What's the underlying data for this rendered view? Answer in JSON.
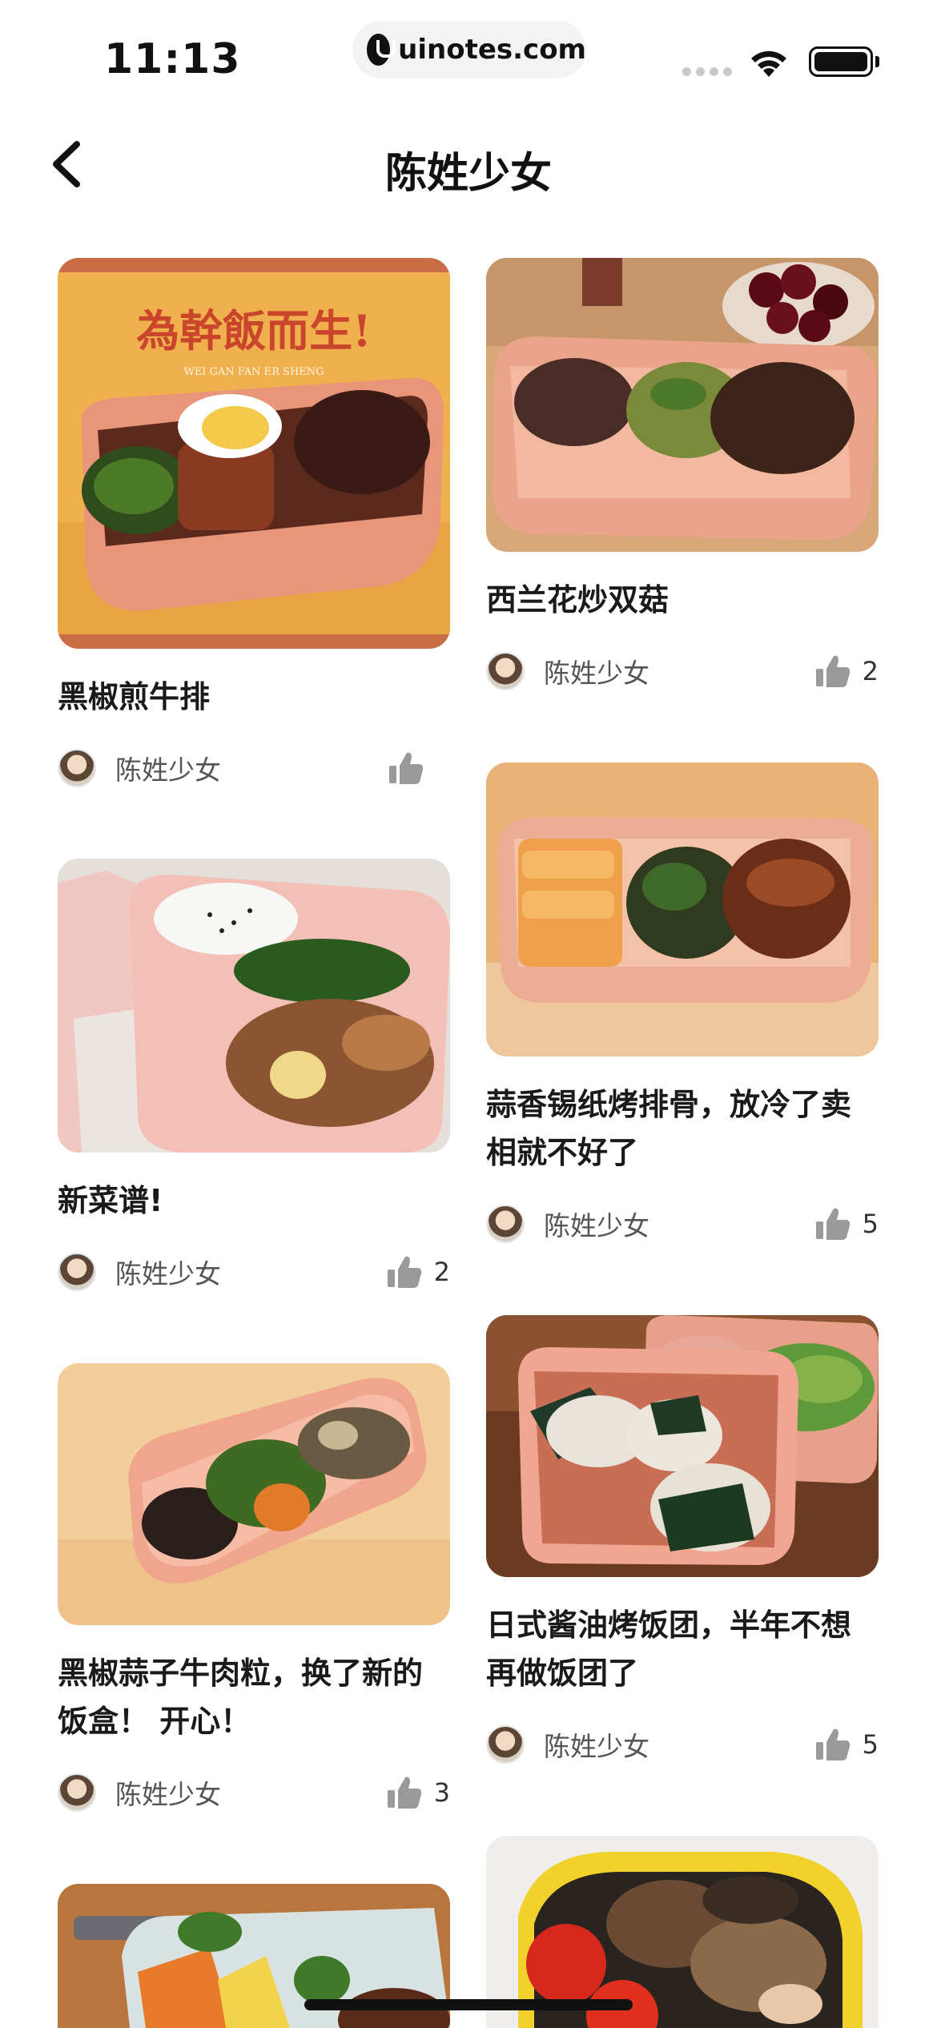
{
  "status": {
    "time": "11:13",
    "url": "uinotes.com",
    "icons": [
      "uinotes-logo-icon",
      "signal-icon",
      "wifi-icon",
      "battery-icon"
    ]
  },
  "nav": {
    "title": "陈姓少女",
    "back_icon": "chevron-left-icon"
  },
  "posts": [
    {
      "title": "黑椒煎牛排",
      "author": "陈姓少女",
      "likes": "",
      "image_caption": "為幹飯而生!",
      "image_subcaption": "WEI GAN FAN ER SHENG"
    },
    {
      "title": "西兰花炒双菇",
      "author": "陈姓少女",
      "likes": "2"
    },
    {
      "title": "新菜谱!",
      "author": "陈姓少女",
      "likes": "2"
    },
    {
      "title": "蒜香锡纸烤排骨，放冷了卖相就不好了",
      "author": "陈姓少女",
      "likes": "5"
    },
    {
      "title": "黑椒蒜子牛肉粒，换了新的饭盒！ 开心！",
      "author": "陈姓少女",
      "likes": "3"
    },
    {
      "title": "日式酱油烤饭团，半年不想再做饭团了",
      "author": "陈姓少女",
      "likes": "5"
    }
  ],
  "colors": {
    "lunchbox": "#e9a98c",
    "background": "#ffffff",
    "title": "#1a1a1a",
    "meta": "#555555",
    "like_icon": "#9a9a9a"
  }
}
